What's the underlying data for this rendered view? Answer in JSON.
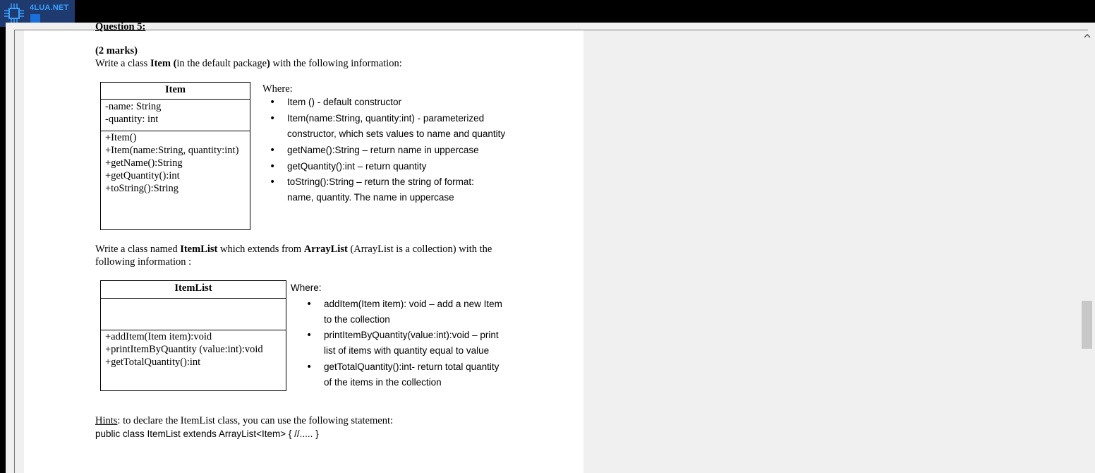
{
  "logo": {
    "text": "4LUA.NET",
    "icon": "circuit-chip-icon"
  },
  "document": {
    "cut_heading": "Question 5:",
    "marks": "(2 marks)",
    "intro": {
      "pre": "Write a class ",
      "class_name": "Item",
      "mid": " (in the default package",
      "close": ")",
      "post": "  with the following information:"
    },
    "item_uml": {
      "title": "Item",
      "attributes": [
        "-name: String",
        "-quantity: int"
      ],
      "methods": [
        "+Item()",
        "+Item(name:String, quantity:int)",
        "+getName():String",
        "+getQuantity():int",
        "+toString():String"
      ]
    },
    "item_where": {
      "label": "Where:",
      "bullets": [
        [
          "Item () - default constructor"
        ],
        [
          "Item(name:String, quantity:int) - parameterized",
          "constructor, which sets values to name and quantity"
        ],
        [
          "getName():String – return name in uppercase"
        ],
        [
          "getQuantity():int – return quantity"
        ],
        [
          "toString():String – return the string of format:",
          "name, quantity. The name in uppercase"
        ]
      ]
    },
    "itemlist_intro": {
      "pre": "Write a class named ",
      "class_name": "ItemList",
      "mid": " which extends from ",
      "base": "ArrayList",
      "post": " (ArrayList is a collection)  with the",
      "line2": "following information :"
    },
    "itemlist_uml": {
      "title": "ItemList",
      "methods": [
        "+addItem(Item item):void",
        "+printItemByQuantity (value:int):void",
        "+getTotalQuantity():int"
      ]
    },
    "itemlist_where": {
      "label": "Where:",
      "bullets": [
        [
          "addItem(Item item): void – add a new Item",
          "to the collection"
        ],
        [
          "printItemByQuantity(value:int):void  –  print",
          "list of items with quantity equal to value"
        ],
        [
          "getTotalQuantity():int- return total quantity",
          "of the items in the collection"
        ]
      ]
    },
    "hints": {
      "label": "Hints",
      "text": ": to declare the ItemList class, you can use the following statement:",
      "code": "public class ItemList extends ArrayList<Item> { //..... }"
    }
  },
  "scrollbar": {
    "up_icon": "chevron-up-icon"
  }
}
